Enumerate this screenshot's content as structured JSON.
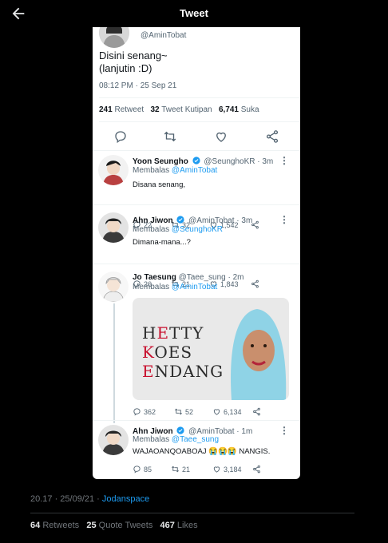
{
  "header": {
    "title": "Tweet",
    "back_icon": "arrow-left-icon"
  },
  "main_tweet": {
    "handle": "@AminTobat",
    "text_line1": "Disini senang~",
    "text_line2": "(lanjutin :D)",
    "time": "08:12 PM · 25 Sep 21",
    "retweets": "241",
    "retweets_label": "Retweet",
    "quotes": "32",
    "quotes_label": "Tweet Kutipan",
    "likes": "6,741",
    "likes_label": "Suka"
  },
  "replies": [
    {
      "name": "Yoon Seungho",
      "handle": "@SeunghoKR · 3m",
      "replying_prefix": "Membalas",
      "replying_to": "@AminTobat",
      "text": "Disana senang,",
      "replies": "22",
      "retweets": "32",
      "likes": "1,542"
    },
    {
      "name": "Ahn Jiwon",
      "handle": "@AminTobat · 3m",
      "replying_prefix": "Membalas",
      "replying_to": "@SeunghoKR",
      "text": "Dimana-mana...?",
      "replies": "26",
      "retweets": "21",
      "likes": "1,843"
    },
    {
      "name": "Jo Taesung",
      "handle": "@Taee_sung · 2m",
      "replying_prefix": "Membalas",
      "replying_to": "@AminTobat",
      "media_line1": "HETTY",
      "media_line2": "KOES",
      "media_line3": "ENDANG",
      "replies": "362",
      "retweets": "52",
      "likes": "6,134"
    },
    {
      "name": "Ahn Jiwon",
      "handle": "@AminTobat · 1m",
      "replying_prefix": "Membalas",
      "replying_to": "@Taee_sung",
      "text_before": "WAJAOANQOABOAJ",
      "emoji": "😭😭😭",
      "text_after": "NANGIS.",
      "replies": "85",
      "retweets": "21",
      "likes": "3,184"
    }
  ],
  "footer": {
    "time": "20.17 · 25/09/21 ·",
    "source": "Jodanspace",
    "retweets": "64",
    "retweets_label": "Retweets",
    "quotes": "25",
    "quotes_label": "Quote Tweets",
    "likes": "467",
    "likes_label": "Likes"
  },
  "colors": {
    "background": "#000000",
    "accent": "#1d9bf0",
    "card": "#ffffff"
  }
}
